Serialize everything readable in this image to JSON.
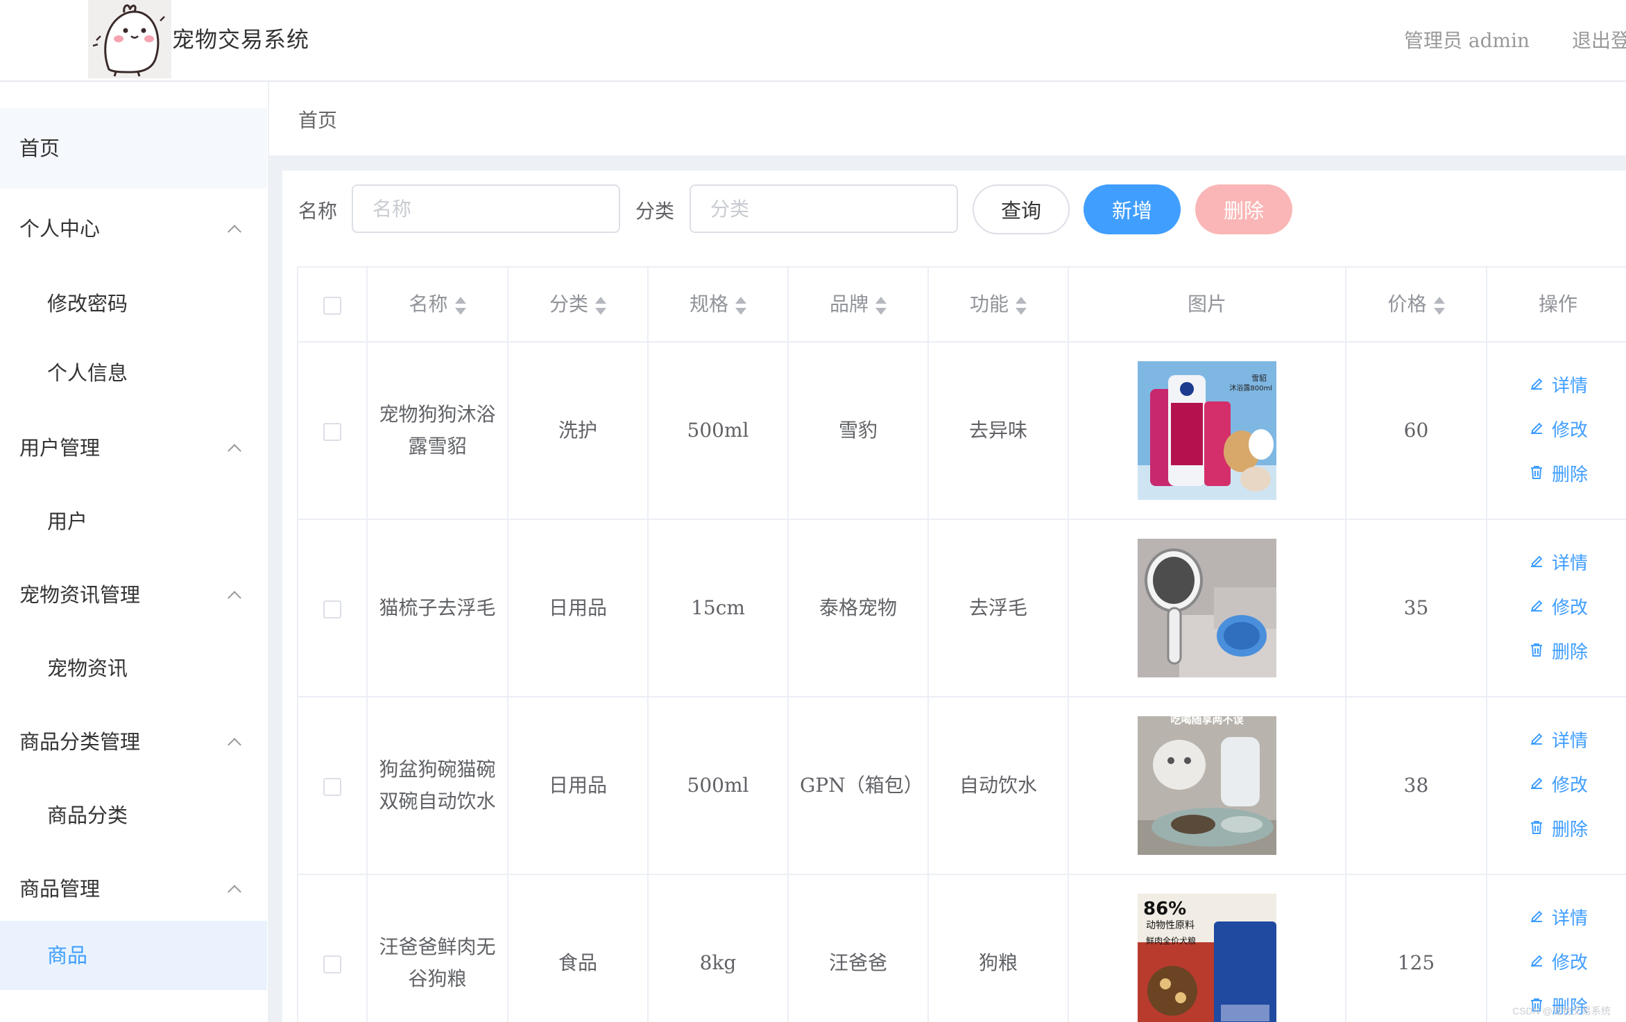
{
  "header": {
    "title": "宠物交易系统",
    "user_text": "管理员 admin",
    "logout_label": "退出登"
  },
  "sidebar": {
    "home": "首页",
    "groups": [
      {
        "label": "个人中心",
        "items": [
          "修改密码",
          "个人信息"
        ]
      },
      {
        "label": "用户管理",
        "items": [
          "用户"
        ]
      },
      {
        "label": "宠物资讯管理",
        "items": [
          "宠物资讯"
        ]
      },
      {
        "label": "商品分类管理",
        "items": [
          "商品分类"
        ]
      },
      {
        "label": "商品管理",
        "items": [
          "商品"
        ]
      }
    ],
    "active_item": "商品"
  },
  "breadcrumb": "首页",
  "search": {
    "name_label": "名称",
    "name_placeholder": "名称",
    "category_label": "分类",
    "category_placeholder": "分类",
    "query_button": "查询",
    "add_button": "新增",
    "delete_button": "删除"
  },
  "table": {
    "headers": [
      "名称",
      "分类",
      "规格",
      "品牌",
      "功能",
      "图片",
      "价格",
      "操作"
    ],
    "actions": {
      "detail": "详情",
      "edit": "修改",
      "delete": "删除"
    },
    "rows": [
      {
        "name": "宠物狗狗沐浴露雪貂",
        "category": "洗护",
        "spec": "500ml",
        "brand": "雪豹",
        "function": "去异味",
        "image_name": "shampoo-product-image",
        "price": "60"
      },
      {
        "name": "猫梳子去浮毛",
        "category": "日用品",
        "spec": "15cm",
        "brand": "泰格宠物",
        "function": "去浮毛",
        "image_name": "cat-comb-product-image",
        "price": "35"
      },
      {
        "name": "狗盆狗碗猫碗双碗自动饮水",
        "category": "日用品",
        "spec": "500ml",
        "brand": "GPN（箱包）",
        "function": "自动饮水",
        "image_name": "pet-bowl-product-image",
        "price": "38"
      },
      {
        "name": "汪爸爸鲜肉无谷狗粮",
        "category": "食品",
        "spec": "8kg",
        "brand": "汪爸爸",
        "function": "狗粮",
        "image_name": "dog-food-product-image",
        "price": "125"
      }
    ]
  },
  "images": {
    "shampoo_text_top": "雪貂",
    "shampoo_text_sub": "沐浴露800ml",
    "dogfood_pct": "86%",
    "dogfood_line1": "动物性原料",
    "dogfood_line2": "鲜肉全价犬粮",
    "bowl_text": "吃喝随享两不误"
  },
  "colors": {
    "primary": "#409eff",
    "danger_light": "#fab6b6",
    "active_bg": "#eaf3fd",
    "content_bg": "#edf1f5",
    "border": "#ebeef5"
  },
  "watermark": "CSDN @宠物交易系统"
}
